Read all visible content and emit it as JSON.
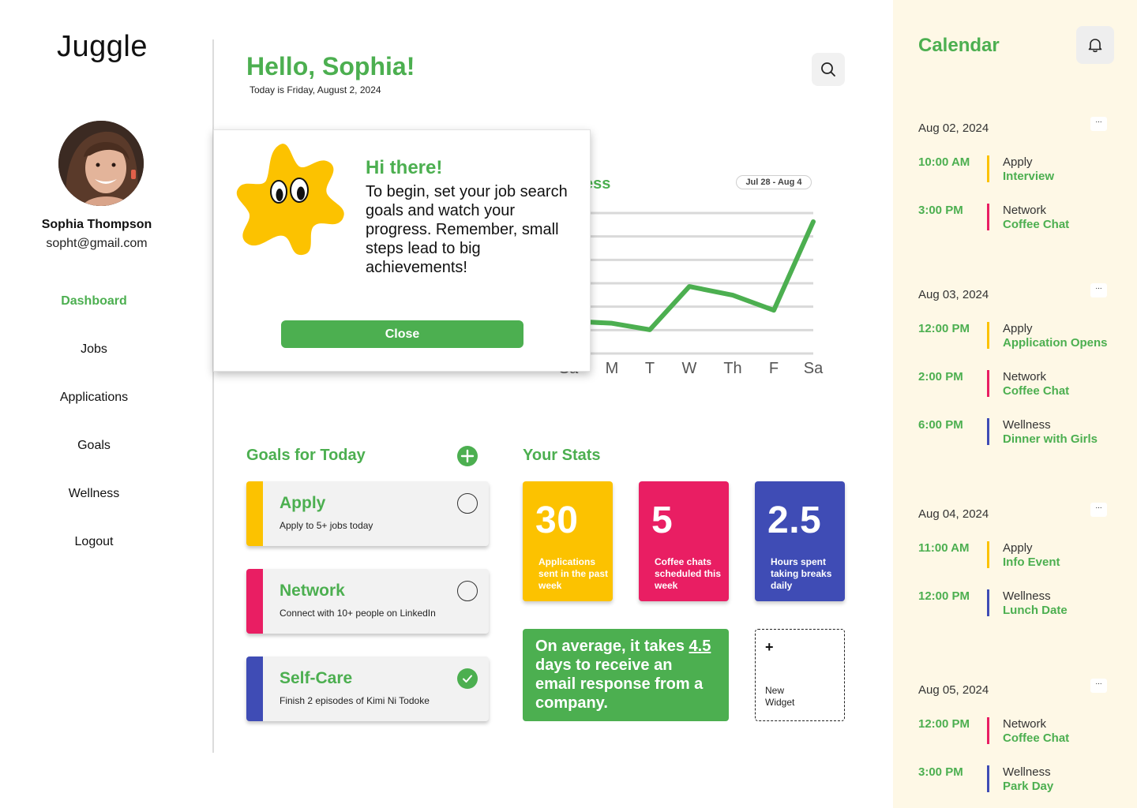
{
  "app": {
    "name": "Juggle"
  },
  "user": {
    "name": "Sophia Thompson",
    "email": "sopht@gmail.com"
  },
  "nav": [
    {
      "label": "Dashboard",
      "active": true
    },
    {
      "label": "Jobs"
    },
    {
      "label": "Applications"
    },
    {
      "label": "Goals"
    },
    {
      "label": "Wellness"
    },
    {
      "label": "Logout"
    }
  ],
  "header": {
    "greeting": "Hello, Sophia!",
    "date_line": "Today is Friday, August 2, 2024",
    "search_icon": "search-icon"
  },
  "chart": {
    "title_visible": "ess",
    "range": "Jul 28 - Aug 4"
  },
  "chart_data": {
    "type": "line",
    "categories": [
      "Su",
      "M",
      "T",
      "W",
      "Th",
      "F",
      "Sa"
    ],
    "visible_tick_labels": [
      "Sa",
      "M",
      "T",
      "W",
      "Th",
      "F",
      "Sa"
    ],
    "values": [
      1.5,
      1.4,
      1.1,
      3.1,
      2.7,
      2.0,
      6.1
    ],
    "ylim": [
      0,
      6.5
    ],
    "grid": true,
    "color": "#4caf50"
  },
  "modal": {
    "title": "Hi there!",
    "body": "To begin, set your job search goals and watch your progress. Remember, small steps lead to big achievements!",
    "close_label": "Close"
  },
  "goals": {
    "title": "Goals for Today",
    "items": [
      {
        "title": "Apply",
        "desc": "Apply to 5+ jobs today",
        "color": "#fcc200",
        "done": false
      },
      {
        "title": "Network",
        "desc": "Connect with 10+ people on LinkedIn",
        "color": "#e91e63",
        "done": false
      },
      {
        "title": "Self-Care",
        "desc": "Finish 2 episodes of Kimi Ni Todoke",
        "color": "#3f4cb5",
        "done": true
      }
    ]
  },
  "stats": {
    "title": "Your Stats",
    "cards": [
      {
        "value": "30",
        "label": "Applications sent in the past week",
        "color": "#fcc200"
      },
      {
        "value": "5",
        "label": "Coffee chats scheduled this week",
        "color": "#e91e63"
      },
      {
        "value": "2.5",
        "label": "Hours spent taking breaks daily",
        "color": "#3f4cb5"
      }
    ],
    "avg": {
      "before": "On average, it takes ",
      "num": "4.5",
      "after": " days to receive an email response from a company."
    },
    "new_widget": {
      "plus": "+",
      "label": "New Widget"
    }
  },
  "calendar": {
    "title": "Calendar",
    "bell_icon": "bell-icon",
    "more_label": "...",
    "days": [
      {
        "date": "Aug 02, 2024",
        "events": [
          {
            "time": "10:00 AM",
            "category": "Apply",
            "title": "Interview",
            "color": "#fcc200"
          },
          {
            "time": "3:00 PM",
            "category": "Network",
            "title": "Coffee Chat",
            "color": "#e91e63"
          }
        ]
      },
      {
        "date": "Aug 03, 2024",
        "events": [
          {
            "time": "12:00 PM",
            "category": "Apply",
            "title": "Application Opens",
            "color": "#fcc200"
          },
          {
            "time": "2:00 PM",
            "category": "Network",
            "title": "Coffee Chat",
            "color": "#e91e63"
          },
          {
            "time": "6:00 PM",
            "category": "Wellness",
            "title": "Dinner with Girls",
            "color": "#3f4cb5"
          }
        ]
      },
      {
        "date": "Aug 04, 2024",
        "events": [
          {
            "time": "11:00 AM",
            "category": "Apply",
            "title": "Info Event",
            "color": "#fcc200"
          },
          {
            "time": "12:00 PM",
            "category": "Wellness",
            "title": "Lunch Date",
            "color": "#3f4cb5"
          }
        ]
      },
      {
        "date": "Aug 05, 2024",
        "events": [
          {
            "time": "12:00 PM",
            "category": "Network",
            "title": "Coffee Chat",
            "color": "#e91e63"
          },
          {
            "time": "3:00 PM",
            "category": "Wellness",
            "title": "Park Day",
            "color": "#3f4cb5"
          }
        ]
      }
    ]
  }
}
